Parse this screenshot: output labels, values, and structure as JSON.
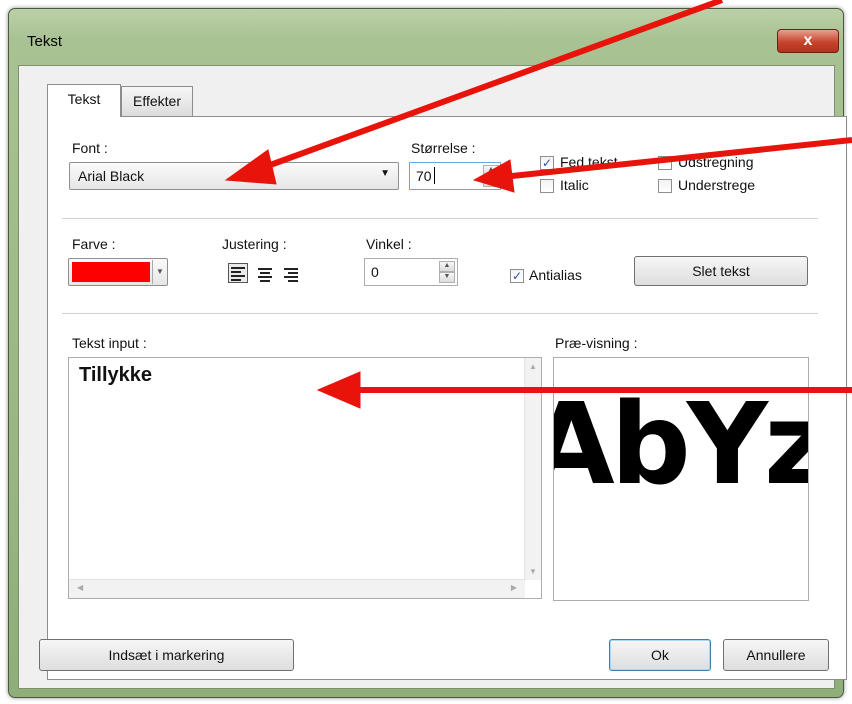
{
  "window": {
    "title": "Tekst",
    "close_glyph": "x"
  },
  "tabs": [
    {
      "label": "Tekst",
      "active": true
    },
    {
      "label": "Effekter",
      "active": false
    }
  ],
  "font": {
    "label": "Font :",
    "value": "Arial Black"
  },
  "size": {
    "label": "Størrelse :",
    "value": "70"
  },
  "style": {
    "bold": {
      "label": "Fed tekst",
      "checked": true
    },
    "italic": {
      "label": "Italic",
      "checked": false
    },
    "strike": {
      "label": "Udstregning",
      "checked": false
    },
    "underline": {
      "label": "Understrege",
      "checked": false
    }
  },
  "color": {
    "label": "Farve :",
    "value": "#ff0000"
  },
  "alignment": {
    "label": "Justering :",
    "options": [
      "left",
      "center",
      "right"
    ],
    "selected": "left"
  },
  "angle": {
    "label": "Vinkel :",
    "value": "0"
  },
  "antialias": {
    "label": "Antialias",
    "checked": true
  },
  "delete_text_button": "Slet tekst",
  "text_input": {
    "label": "Tekst input :",
    "value": "Tillykke"
  },
  "preview": {
    "label": "Præ-visning :",
    "sample": "AbYz"
  },
  "buttons": {
    "insert": "Indsæt i markering",
    "ok": "Ok",
    "cancel": "Annullere"
  },
  "annotation_color": "#e8140c"
}
